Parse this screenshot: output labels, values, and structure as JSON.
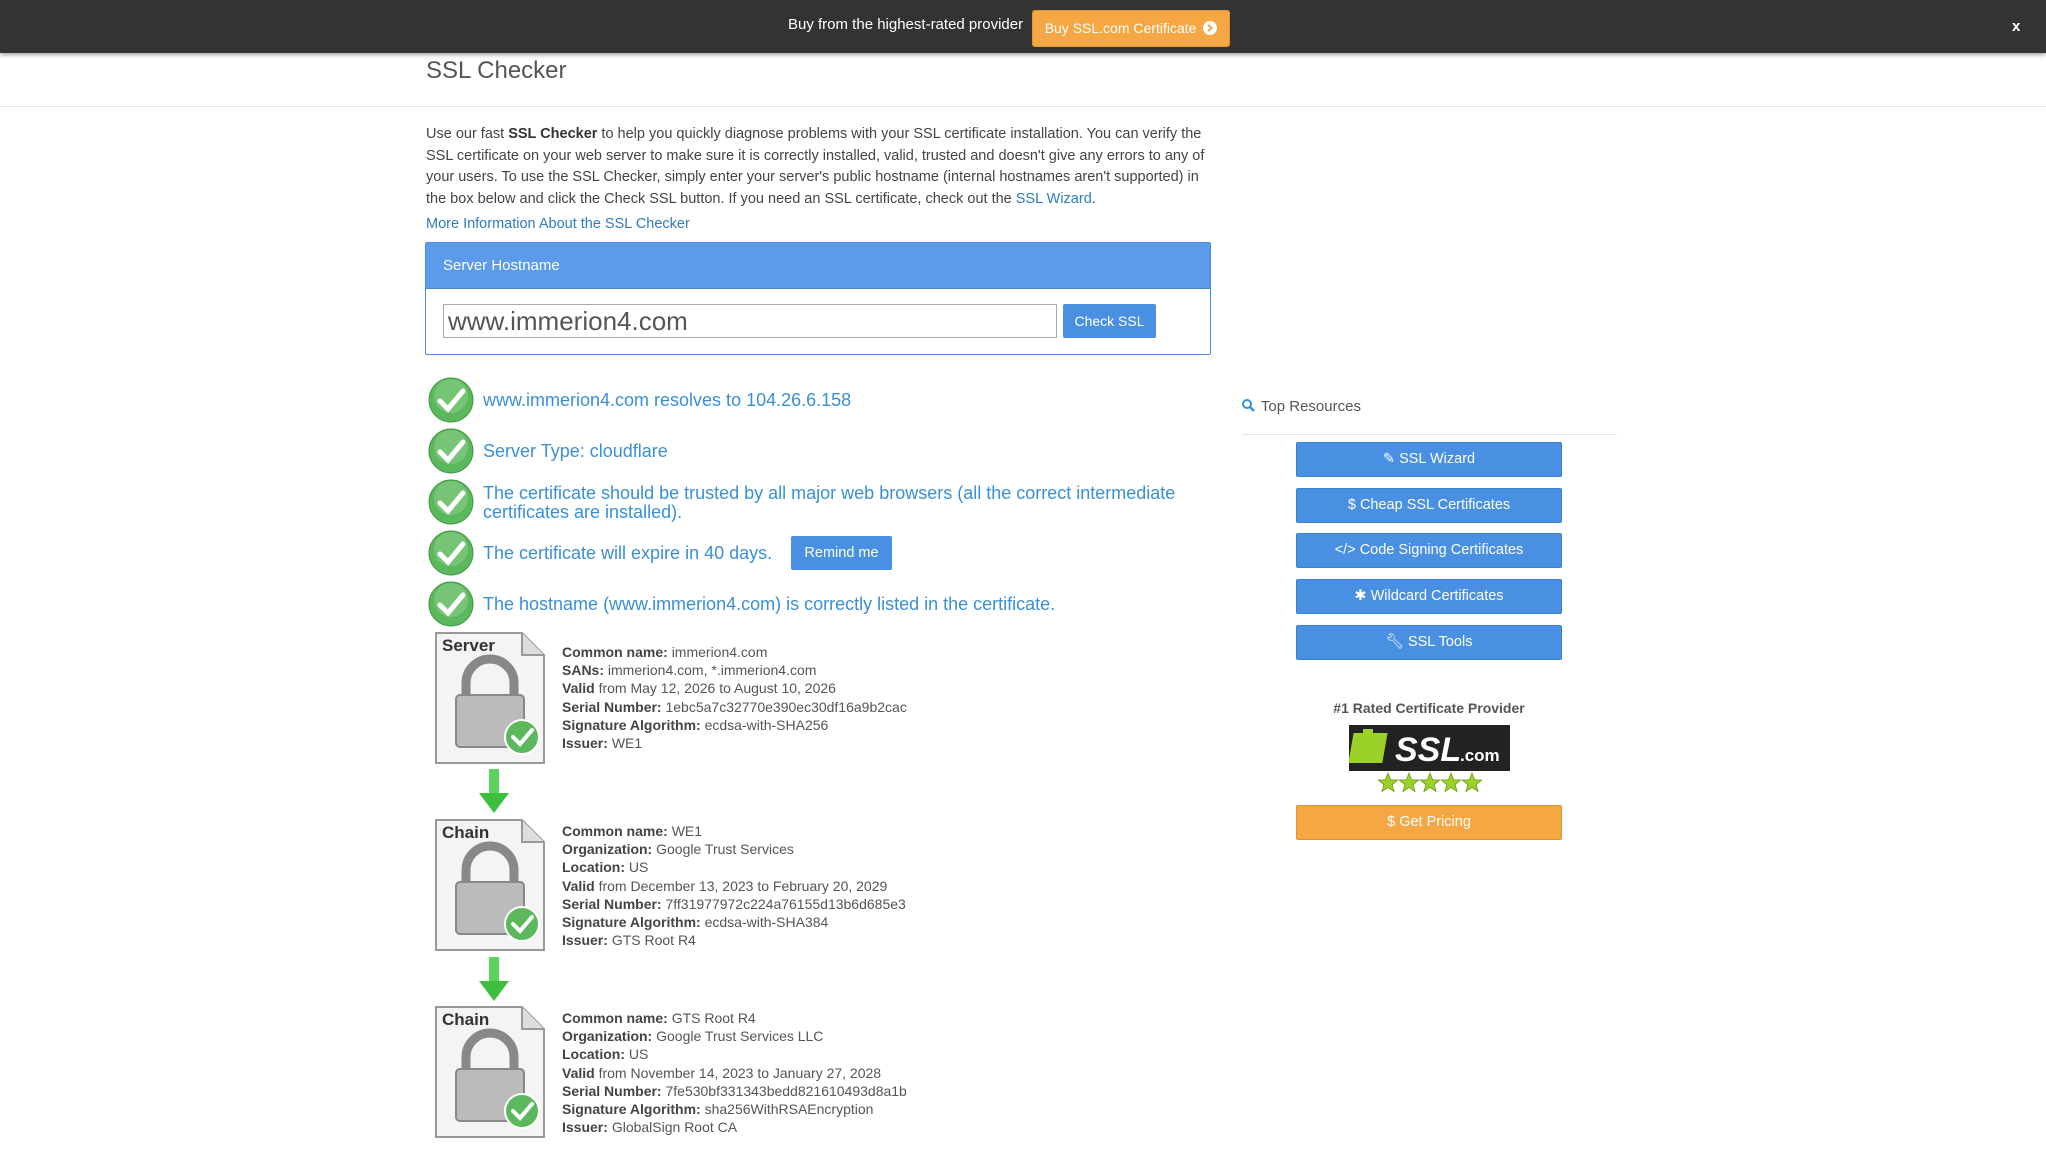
{
  "topbar": {
    "promo_text": "Buy from the highest-rated provider",
    "buy_button": "Buy SSL.com Certificate",
    "close": "x"
  },
  "page": {
    "title": "SSL Checker",
    "intro_1": "Use our fast ",
    "intro_bold": "SSL Checker",
    "intro_2": " to help you quickly diagnose problems with your SSL certificate installation. You can verify the SSL certificate on your web server to make sure it is correctly installed, valid, trusted and doesn't give any errors to any of your users. To use the SSL Checker, simply enter your server's public hostname (internal hostnames aren't supported) in the box below and click the Check SSL button. If you need an SSL certificate, check out the ",
    "intro_link": "SSL Wizard",
    "intro_end": ".",
    "more_info_link": "More Information About the SSL Checker"
  },
  "form": {
    "panel_title": "Server Hostname",
    "hostname_value": "www.immerion4.com",
    "check_button": "Check SSL"
  },
  "results": {
    "resolves": "www.immerion4.com resolves to 104.26.6.158",
    "server_type": "Server Type: cloudflare",
    "trusted_1": "The certificate should be trusted by all major web browsers (all the correct intermediate",
    "trusted_2": "certificates are installed).",
    "expire": "The certificate will expire in 40 days.",
    "remind_button": "Remind me",
    "hostname_listed": "The hostname (www.immerion4.com) is correctly listed in the certificate."
  },
  "labels": {
    "common_name": "Common name:",
    "sans": "SANs:",
    "organization": "Organization:",
    "location": "Location:",
    "valid": "Valid",
    "serial": "Serial Number:",
    "sig_alg": "Signature Algorithm:",
    "issuer": "Issuer:"
  },
  "certs": [
    {
      "icon_label": "Server",
      "common_name": "immerion4.com",
      "sans": "immerion4.com, *.immerion4.com",
      "valid": "from May 12, 2026 to August 10, 2026",
      "serial": "1ebc5a7c32770e390ec30df16a9b2cac",
      "sig_alg": "ecdsa-with-SHA256",
      "issuer": "WE1"
    },
    {
      "icon_label": "Chain",
      "common_name": "WE1",
      "organization": "Google Trust Services",
      "location": "US",
      "valid": "from December 13, 2023 to February 20, 2029",
      "serial": "7ff31977972c224a76155d13b6d685e3",
      "sig_alg": "ecdsa-with-SHA384",
      "issuer": "GTS Root R4"
    },
    {
      "icon_label": "Chain",
      "common_name": "GTS Root R4",
      "organization": "Google Trust Services LLC",
      "location": "US",
      "valid": "from November 14, 2023 to January 27, 2028",
      "serial": "7fe530bf331343bedd821610493d8a1b",
      "sig_alg": "sha256WithRSAEncryption",
      "issuer": "GlobalSign Root CA"
    }
  ],
  "sidebar": {
    "title": "Top Resources",
    "buttons": [
      "SSL Wizard",
      "Cheap SSL Certificates",
      "Code Signing Certificates",
      "Wildcard Certificates",
      "SSL Tools"
    ],
    "rated_text": "#1 Rated Certificate Provider",
    "logo_text": "SSL",
    "logo_suffix": ".com",
    "pricing_button": "Get Pricing"
  },
  "colors": {
    "primary": "#4a90e2",
    "accent": "#f4a742",
    "success": "#5cb85c",
    "topbar": "#333333"
  }
}
